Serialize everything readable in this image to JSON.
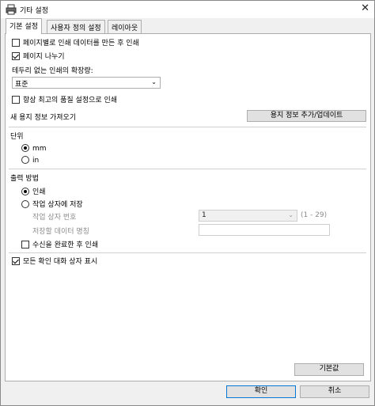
{
  "window": {
    "title": "기타 설정"
  },
  "tabs": [
    {
      "label": "기본 설정",
      "active": true
    },
    {
      "label": "사용자 정의 설정",
      "active": false
    },
    {
      "label": "레이아웃",
      "active": false
    }
  ],
  "print_options": {
    "print_after_page_data": {
      "label": "페이지별로 인쇄 데이터를 만든 후 인쇄",
      "checked": false
    },
    "page_split": {
      "label": "페이지 나누기",
      "checked": true
    },
    "borderless_extension_label": "테두리 없는 인쇄의 확장량:",
    "borderless_extension_value": "표준",
    "always_best_quality": {
      "label": "항상 최고의 품질 설정으로 인쇄",
      "checked": false
    }
  },
  "paper_info": {
    "label": "새 용지 정보 가져오기",
    "button": "용지 정보 추가/업데이트"
  },
  "unit": {
    "label": "단위",
    "options": [
      {
        "label": "mm",
        "checked": true
      },
      {
        "label": "in",
        "checked": false
      }
    ]
  },
  "output": {
    "label": "출력 방법",
    "options": [
      {
        "label": "인쇄",
        "checked": true
      },
      {
        "label": "작업 상자에 저장",
        "checked": false
      }
    ],
    "job_box_label": "작업 상자 번호",
    "job_box_value": "1",
    "job_box_range": "(1 - 29)",
    "data_name_label": "저장할 데이터 명칭",
    "data_name_value": "",
    "print_after_receive": {
      "label": "수신을 완료한 후 인쇄",
      "checked": false
    }
  },
  "show_all_confirm": {
    "label": "모든 확인 대화 상자 표시",
    "checked": true
  },
  "buttons": {
    "defaults": "기본값",
    "ok": "확인",
    "cancel": "취소"
  },
  "colors": {
    "accent": "#0078d7",
    "panel": "#ffffff",
    "window": "#f0f0f0"
  }
}
